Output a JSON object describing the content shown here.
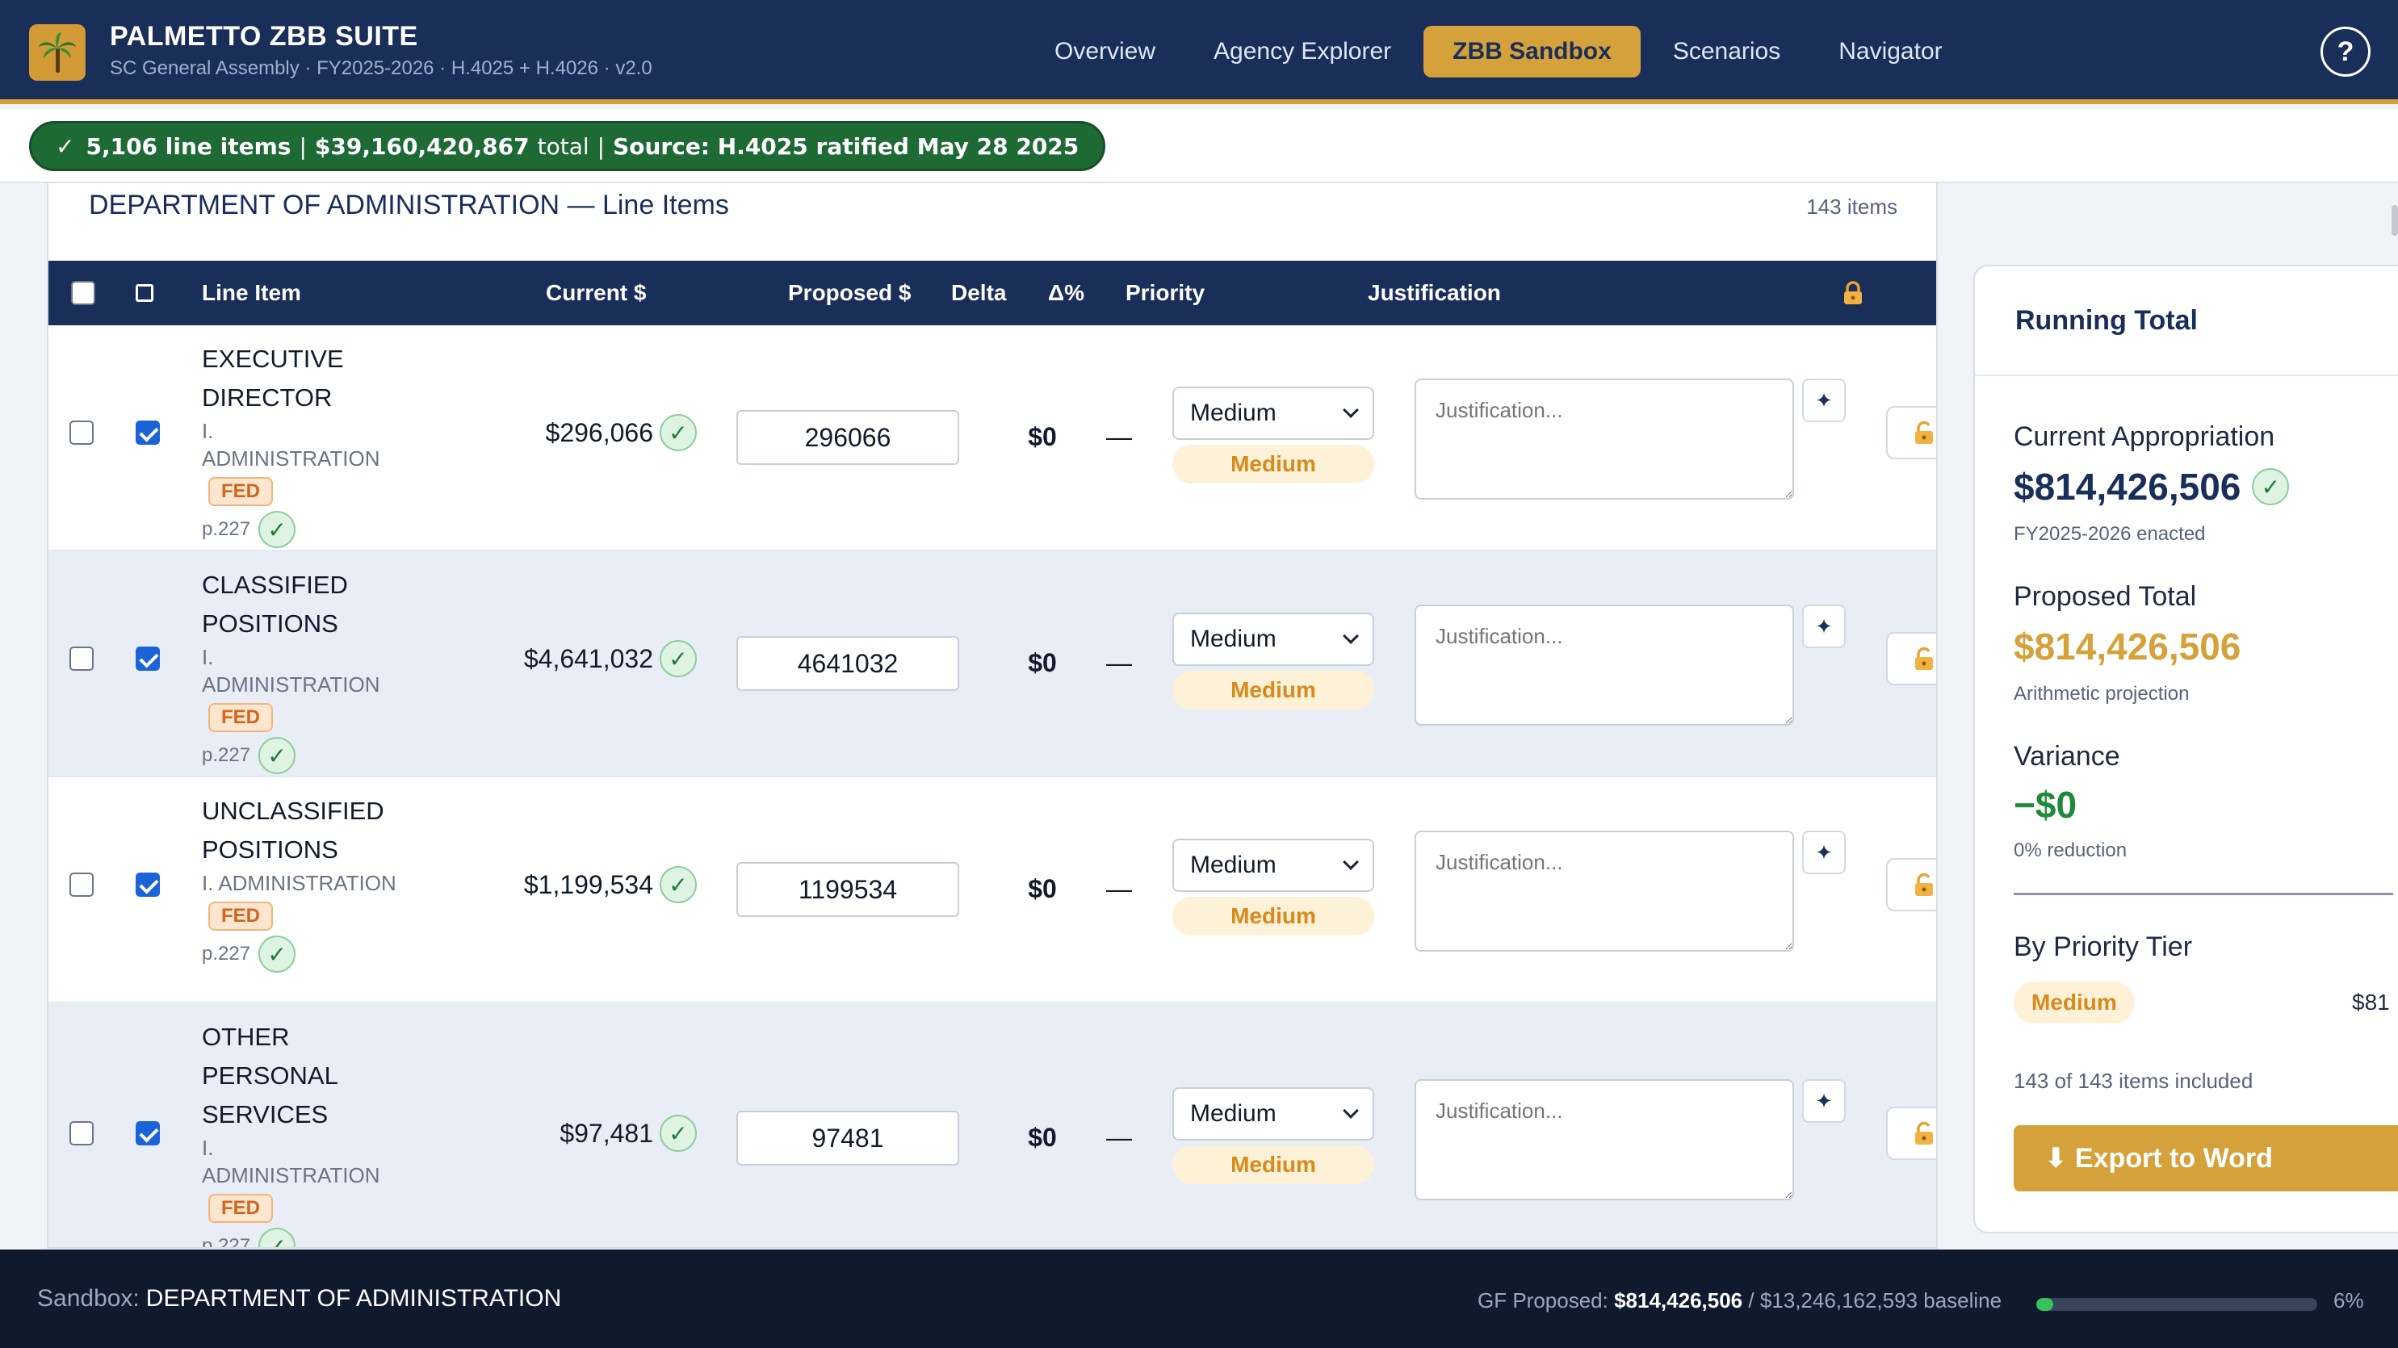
{
  "app": {
    "title": "PALMETTO ZBB SUITE",
    "subtitle": "SC General Assembly · FY2025-2026 · H.4025 + H.4026 · v2.0"
  },
  "nav": {
    "items": [
      "Overview",
      "Agency Explorer",
      "ZBB Sandbox",
      "Scenarios",
      "Navigator"
    ],
    "active": "ZBB Sandbox",
    "help": "?"
  },
  "status": {
    "check": "✓",
    "count": "5,106 line items",
    "sep1": "|",
    "total": "$39,160,420,867",
    "total_suffix": "total",
    "sep2": "|",
    "source": "Source: H.4025 ratified May 28 2025"
  },
  "panel": {
    "title": "DEPARTMENT OF ADMINISTRATION — Line Items",
    "count": "143 items"
  },
  "table": {
    "headers": {
      "line_item": "Line Item",
      "current": "Current $",
      "proposed": "Proposed $",
      "delta": "Delta",
      "delta_pct": "Δ%",
      "priority": "Priority",
      "justification": "Justification"
    },
    "rows": [
      {
        "name_lines": [
          "EXECUTIVE",
          "DIRECTOR"
        ],
        "dept": "I. ADMINISTRATION",
        "fund": "FED",
        "page": "p.227",
        "current": "$296,066",
        "proposed": "296066",
        "delta": "$0",
        "delta_pct": "—",
        "priority": "Medium",
        "priority_badge": "Medium",
        "justification_placeholder": "Justification...",
        "checked": true
      },
      {
        "name_lines": [
          "CLASSIFIED",
          "POSITIONS"
        ],
        "dept": "I. ADMINISTRATION",
        "fund": "FED",
        "page": "p.227",
        "current": "$4,641,032",
        "proposed": "4641032",
        "delta": "$0",
        "delta_pct": "—",
        "priority": "Medium",
        "priority_badge": "Medium",
        "justification_placeholder": "Justification...",
        "checked": true
      },
      {
        "name_lines": [
          "UNCLASSIFIED",
          "POSITIONS"
        ],
        "dept": "I. ADMINISTRATION",
        "fund": "FED",
        "page": "p.227",
        "current": "$1,199,534",
        "proposed": "1199534",
        "delta": "$0",
        "delta_pct": "—",
        "priority": "Medium",
        "priority_badge": "Medium",
        "justification_placeholder": "Justification...",
        "checked": true
      },
      {
        "name_lines": [
          "OTHER",
          "PERSONAL",
          "SERVICES"
        ],
        "dept": "I. ADMINISTRATION",
        "fund": "FED",
        "page": "p.227",
        "current": "$97,481",
        "proposed": "97481",
        "delta": "$0",
        "delta_pct": "—",
        "priority": "Medium",
        "priority_badge": "Medium",
        "justification_placeholder": "Justification...",
        "checked": true
      }
    ]
  },
  "running_total": {
    "title": "Running Total",
    "current_label": "Current Appropriation",
    "current_value": "$814,426,506",
    "current_note": "FY2025-2026 enacted",
    "proposed_label": "Proposed Total",
    "proposed_value": "$814,426,506",
    "proposed_note": "Arithmetic projection",
    "variance_label": "Variance",
    "variance_value": "−$0",
    "variance_note": "0% reduction",
    "tier_label": "By Priority Tier",
    "tier_name": "Medium",
    "tier_amount": "$81",
    "included_note": "143 of 143 items included",
    "export_label": "⬇ Export to Word"
  },
  "footer": {
    "sandbox_label": "Sandbox:",
    "sandbox_value": "DEPARTMENT OF ADMINISTRATION",
    "gf_label": "GF Proposed:",
    "gf_value": "$814,426,506",
    "baseline": "/ $13,246,162,593 baseline",
    "progress_percent": 6,
    "progress_label": "6%"
  },
  "colors": {
    "navy": "#1a2e5a",
    "gold": "#d4a13a",
    "status_green": "#1e6a35",
    "variance_green": "#1f8a3a",
    "medium_orange": "#d98a1b",
    "fed_orange": "#d2641b",
    "progress_green": "#36c35b"
  },
  "icons": {
    "logo": "palmetto-tree-icon",
    "verified": "check-circle-icon",
    "ai": "sparkle-icon",
    "lock_header": "lock-icon",
    "lock_row": "unlock-icon",
    "export": "download-icon"
  }
}
